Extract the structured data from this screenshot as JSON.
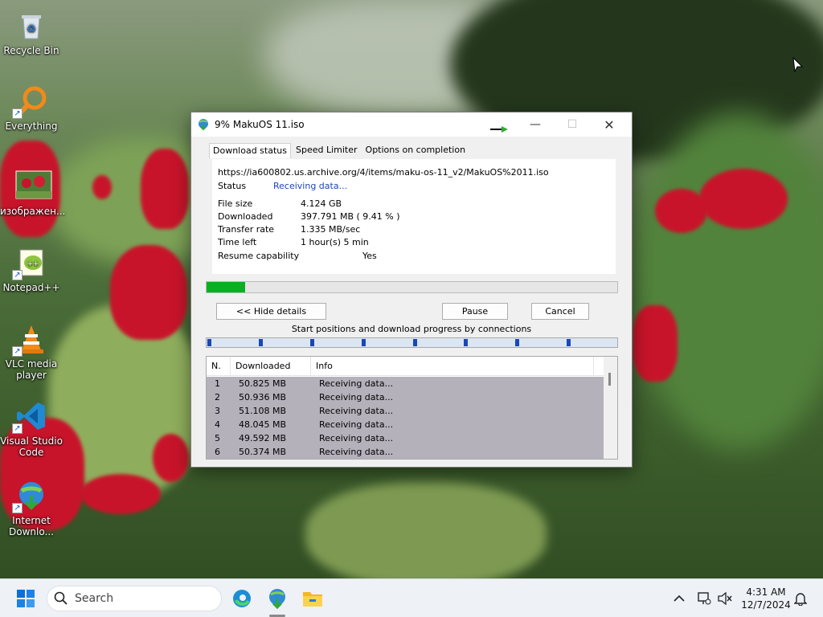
{
  "desktop": {
    "icons": [
      {
        "label": "Recycle Bin",
        "icon": "recycle-bin-icon"
      },
      {
        "label": "Everything",
        "icon": "magnifier-icon"
      },
      {
        "label": "изображен...",
        "icon": "image-file-icon"
      },
      {
        "label": "Notepad++",
        "icon": "notepad-plus-icon"
      },
      {
        "label": "VLC media player",
        "icon": "vlc-cone-icon"
      },
      {
        "label": "Visual Studio Code",
        "icon": "vscode-icon"
      },
      {
        "label": "Internet Downlo...",
        "icon": "idm-globe-icon"
      }
    ]
  },
  "window": {
    "title": "9% MakuOS 11.iso",
    "tabs": [
      "Download status",
      "Speed Limiter",
      "Options on completion"
    ],
    "url": "https://ia600802.us.archive.org/4/items/maku-os-11_v2/MakuOS%2011.iso",
    "status_label": "Status",
    "status_value": "Receiving data...",
    "details": [
      {
        "label": "File size",
        "value": "4.124  GB"
      },
      {
        "label": "Downloaded",
        "value": "397.791  MB  ( 9.41 % )"
      },
      {
        "label": "Transfer rate",
        "value": "1.335  MB/sec"
      },
      {
        "label": "Time left",
        "value": "1 hour(s) 5 min"
      }
    ],
    "resume_label": "Resume capability",
    "resume_value": "Yes",
    "progress_fraction": 0.0941,
    "buttons": {
      "hide_details": "<< Hide details",
      "pause": "Pause",
      "cancel": "Cancel"
    },
    "connections_caption": "Start positions and download progress by connections",
    "table": {
      "columns": [
        "N.",
        "Downloaded",
        "Info"
      ],
      "rows": [
        {
          "n": "1",
          "downloaded": "50.825  MB",
          "info": "Receiving data..."
        },
        {
          "n": "2",
          "downloaded": "50.936  MB",
          "info": "Receiving data..."
        },
        {
          "n": "3",
          "downloaded": "51.108  MB",
          "info": "Receiving data..."
        },
        {
          "n": "4",
          "downloaded": "48.045  MB",
          "info": "Receiving data..."
        },
        {
          "n": "5",
          "downloaded": "49.592  MB",
          "info": "Receiving data..."
        },
        {
          "n": "6",
          "downloaded": "50.374  MB",
          "info": "Receiving data..."
        }
      ]
    }
  },
  "taskbar": {
    "search_placeholder": "Search",
    "time": "4:31 AM",
    "date": "12/7/2024",
    "pinned": [
      "edge-icon",
      "idm-icon",
      "file-explorer-icon"
    ]
  },
  "colors": {
    "progress_green": "#06b025",
    "status_blue": "#1a47b8",
    "row_highlight": "#b5b1bb"
  }
}
